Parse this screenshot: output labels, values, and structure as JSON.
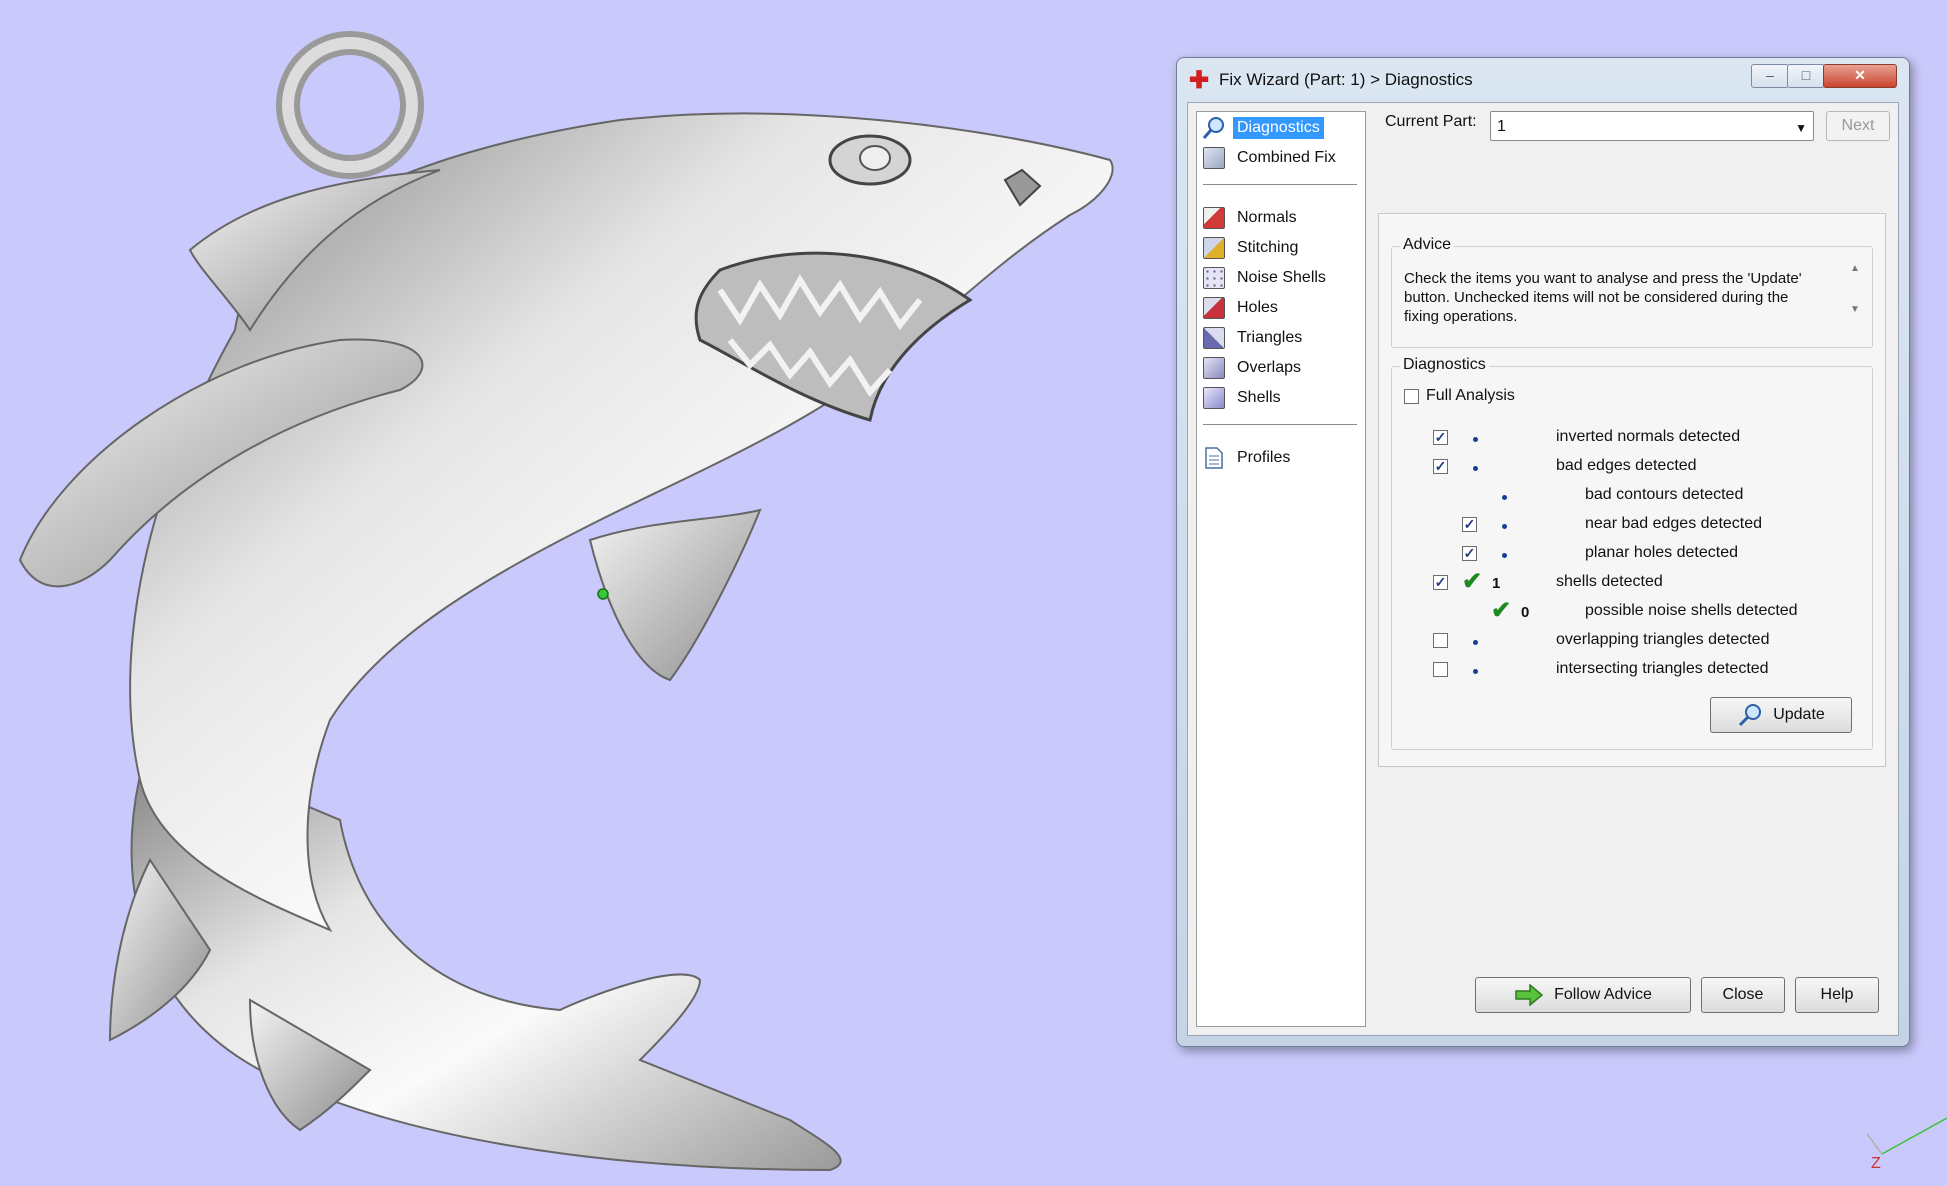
{
  "window": {
    "title": "Fix Wizard (Part: 1) > Diagnostics",
    "minimize_label": "–",
    "maximize_label": "□",
    "close_label": "✕"
  },
  "nav": {
    "top": [
      {
        "label": "Diagnostics",
        "icon": "magnifier-icon",
        "selected": true
      },
      {
        "label": "Combined Fix",
        "icon": "cube-icon"
      }
    ],
    "fixes": [
      {
        "label": "Normals",
        "icon": "normals-cube-icon",
        "color": "#d23a3a"
      },
      {
        "label": "Stitching",
        "icon": "stitching-cube-icon",
        "color": "#e0b02a"
      },
      {
        "label": "Noise Shells",
        "icon": "noise-shells-icon",
        "color": "#6b6b9c"
      },
      {
        "label": "Holes",
        "icon": "holes-cube-icon",
        "color": "#c8323a"
      },
      {
        "label": "Triangles",
        "icon": "triangles-cube-icon",
        "color": "#6a6ab0"
      },
      {
        "label": "Overlaps",
        "icon": "overlaps-cube-icon",
        "color": "#8a8ac0"
      },
      {
        "label": "Shells",
        "icon": "shells-cube-icon",
        "color": "#8b8bd0"
      }
    ],
    "bottom": [
      {
        "label": "Profiles",
        "icon": "document-icon"
      }
    ]
  },
  "current_part": {
    "label": "Current Part:",
    "value": "1",
    "next_label": "Next"
  },
  "advice": {
    "title": "Advice",
    "text": "Check the items you want to analyse and press the 'Update' button. Unchecked items will not be considered during the fixing operations."
  },
  "diagnostics": {
    "title": "Diagnostics",
    "full_analysis_label": "Full Analysis",
    "full_analysis_checked": false,
    "rows": [
      {
        "label": "inverted normals detected",
        "checked": true,
        "status": "dot",
        "count": ""
      },
      {
        "label": "bad edges detected",
        "checked": true,
        "status": "dot",
        "count": ""
      },
      {
        "label": "bad contours detected",
        "checked": null,
        "status": "dot",
        "count": ""
      },
      {
        "label": "near bad edges detected",
        "checked": true,
        "status": "dot",
        "count": ""
      },
      {
        "label": "planar holes detected",
        "checked": true,
        "status": "dot",
        "count": ""
      },
      {
        "label": "shells detected",
        "checked": true,
        "status": "tick",
        "count": "1"
      },
      {
        "label": "possible noise shells detected",
        "checked": null,
        "status": "tick",
        "count": "0"
      },
      {
        "label": "overlapping triangles detected",
        "checked": false,
        "status": "dot",
        "count": ""
      },
      {
        "label": "intersecting triangles detected",
        "checked": false,
        "status": "dot",
        "count": ""
      }
    ],
    "update_label": "Update"
  },
  "footer": {
    "follow_advice_label": "Follow Advice",
    "close_label": "Close",
    "help_label": "Help"
  },
  "viewport": {
    "axis_label": "Z",
    "background_color": "#c9c9fb"
  }
}
